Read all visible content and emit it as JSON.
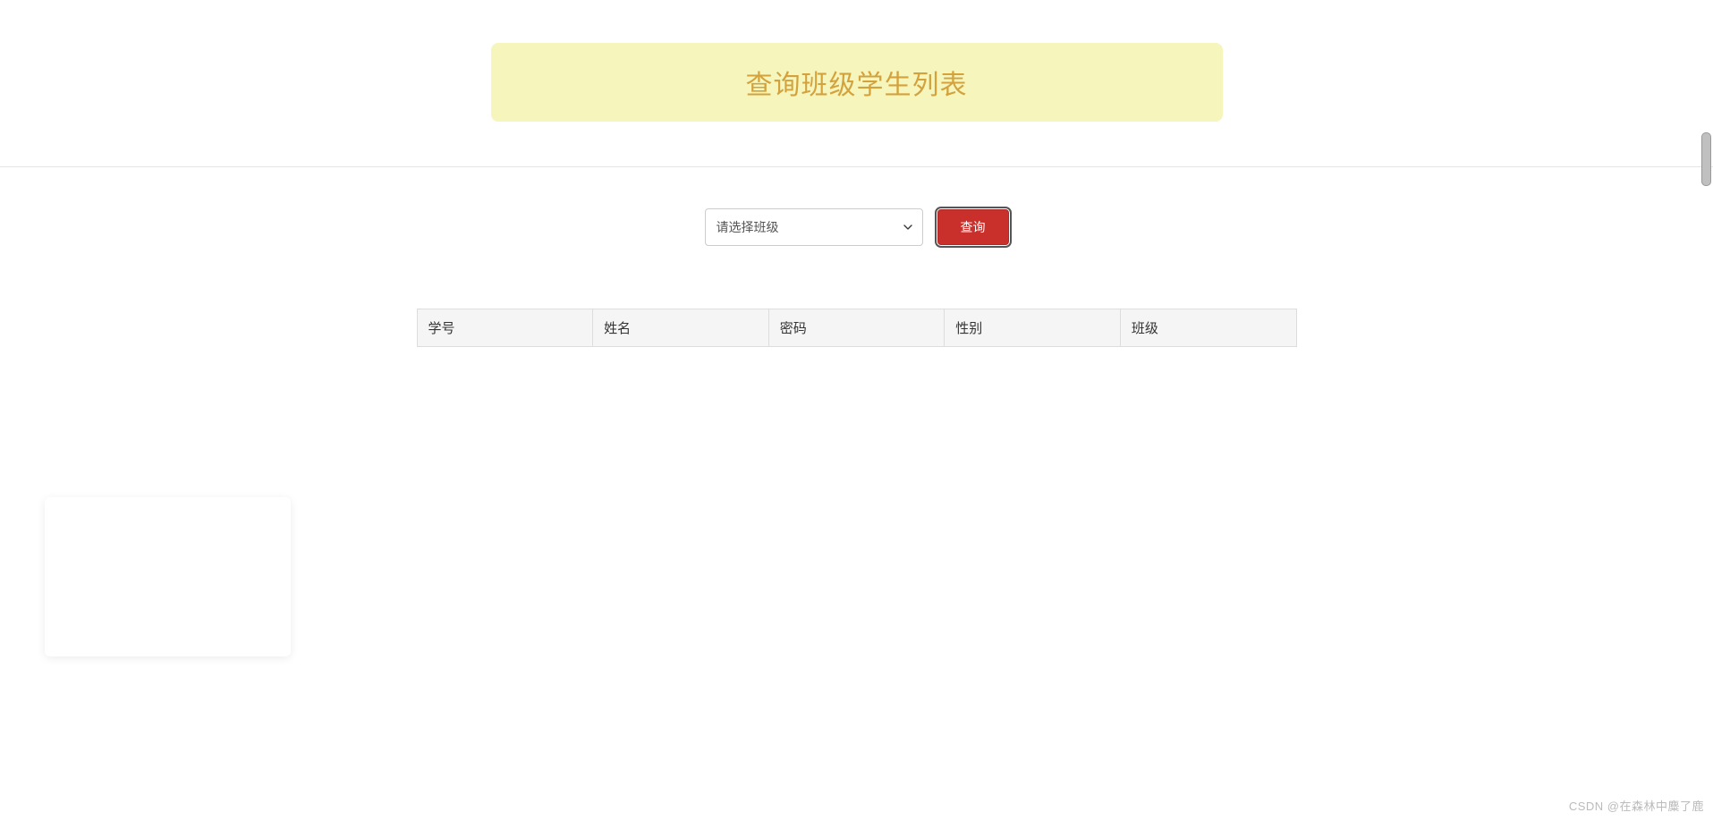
{
  "header": {
    "title": "查询班级学生列表"
  },
  "form": {
    "select_placeholder": "请选择班级",
    "query_button_label": "查询"
  },
  "table": {
    "columns": [
      "学号",
      "姓名",
      "密码",
      "性别",
      "班级"
    ]
  },
  "watermark": "CSDN @在森林中麋了鹿"
}
